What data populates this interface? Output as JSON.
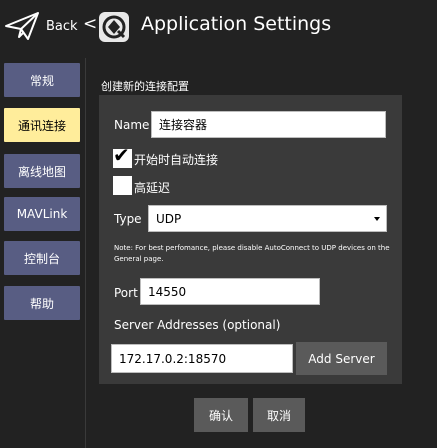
{
  "header": {
    "back_label": "Back",
    "separator": "<",
    "title": "Application Settings"
  },
  "sidebar": {
    "items": [
      {
        "label": "常规",
        "active": false
      },
      {
        "label": "通讯连接",
        "active": true
      },
      {
        "label": "离线地图",
        "active": false
      },
      {
        "label": "MAVLink",
        "active": false
      },
      {
        "label": "控制台",
        "active": false
      },
      {
        "label": "帮助",
        "active": false
      }
    ]
  },
  "form": {
    "section_title": "创建新的连接配置",
    "name_label": "Name",
    "name_value": "连接容器",
    "autoconnect_label": "开始时自动连接",
    "autoconnect_checked": true,
    "high_latency_label": "高延迟",
    "high_latency_checked": false,
    "type_label": "Type",
    "type_value": "UDP",
    "note": "Note: For best perfomance, please disable AutoConnect to UDP devices on the General page.",
    "port_label": "Port",
    "port_value": "14550",
    "server_addresses_label": "Server Addresses (optional)",
    "server_address_value": "172.17.0.2:18570",
    "add_server_label": "Add Server"
  },
  "actions": {
    "ok_label": "确认",
    "cancel_label": "取消"
  },
  "colors": {
    "background": "#222222",
    "panel": "#3a3a3a",
    "sidebar_button": "#585d83",
    "sidebar_active": "#ffed9b",
    "button": "#5a5a5a"
  }
}
